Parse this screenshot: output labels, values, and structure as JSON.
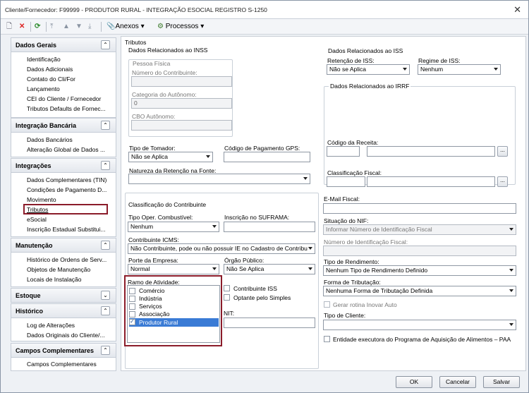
{
  "window": {
    "title": "Cliente/Fornecedor: F99999 - PRODUTOR RURAL - INTEGRAÇÃO ESOCIAL REGISTRO S-1250",
    "close": "✕"
  },
  "toolbar": {
    "anexos": "Anexos",
    "processos": "Processos"
  },
  "sidebar": {
    "dados_gerais": {
      "title": "Dados Gerais",
      "items": [
        "Identificação",
        "Dados Adicionais",
        "Contato do Cli/For",
        "Lançamento",
        "CEI do Cliente / Fornecedor",
        "Tributos Defaults de Fornec..."
      ]
    },
    "integracao_bancaria": {
      "title": "Integração Bancária",
      "items": [
        "Dados Bancários",
        "Alteração Global de Dados ..."
      ]
    },
    "integracoes": {
      "title": "Integrações",
      "items": [
        "Dados Complementares (TIN)",
        "Condições de Pagamento D...",
        "Movimento",
        "Tributos",
        "eSocial",
        "Inscrição Estadual Substitui..."
      ]
    },
    "manutencao": {
      "title": "Manutenção",
      "items": [
        "Histórico de Ordens de Serv...",
        "Objetos de Manutenção",
        "Locais de Instalação"
      ]
    },
    "estoque": {
      "title": "Estoque"
    },
    "historico": {
      "title": "Histórico",
      "items": [
        "Log de Alterações",
        "Dados Originais do Cliente/..."
      ]
    },
    "campos": {
      "title": "Campos Complementares",
      "items": [
        "Campos Complementares"
      ]
    }
  },
  "main": {
    "tab": "Tributos",
    "inss": {
      "title": "Dados Relacionados ao INSS",
      "pf": "Pessoa Física",
      "numero": "Número do Contribuinte:",
      "numero_val": "",
      "categoria": "Categoria do Autônomo:",
      "categoria_val": "0",
      "cbo": "CBO Autônomo:",
      "cbo_val": "",
      "tipo_tomador": "Tipo de Tomador:",
      "tipo_tomador_val": "Não se Aplica",
      "cod_gps": "Código de Pagamento GPS:",
      "natureza": "Natureza da Retenção na Fonte:",
      "natureza_val": ""
    },
    "iss": {
      "title": "Dados Relacionados ao ISS",
      "retencao": "Retenção de ISS:",
      "retencao_val": "Não se Aplica",
      "regime": "Regime de ISS:",
      "regime_val": "Nenhum"
    },
    "irrf": {
      "title": "Dados Relacionados ao IRRF",
      "cod_receita": "Código da Receita:",
      "classif": "Classificação Fiscal:",
      "dots": "..."
    },
    "contrib": {
      "title": "Classificação do Contribuinte",
      "tipo_oper": "Tipo Oper. Combustível:",
      "tipo_oper_val": "Nenhum",
      "suframa": "Inscrição no SUFRAMA:",
      "icms": "Contribuinte ICMS:",
      "icms_val": "Não Contribuinte, pode ou não possuir IE no Cadastro de Contribu",
      "porte": "Porte da Empresa:",
      "porte_val": "Normal",
      "orgao": "Órgão Público:",
      "orgao_val": "Não Se Aplica",
      "ramo": "Ramo de Atividade:",
      "ramo_items": [
        "Comércio",
        "Indústria",
        "Serviços",
        "Associação",
        "Produtor Rural"
      ],
      "contrib_iss": "Contribuinte ISS",
      "optante": "Optante pelo Simples",
      "nit": "NIT:"
    },
    "right": {
      "email": "E-Mail Fiscal:",
      "sit_nif": "Situação do NIF:",
      "sit_nif_val": "Informar Número de Identificação Fiscal",
      "num_nif": "Número de Identificação Fiscal:",
      "tipo_rend": "Tipo de Rendimento:",
      "tipo_rend_val": "Nenhum Tipo de Rendimento Definido",
      "forma_trib": "Forma de Tributação:",
      "forma_trib_val": "Nenhuma Forma de Tributação Definida",
      "gerar": "Gerar rotina Inovar Auto",
      "tipo_cliente": "Tipo de Cliente:",
      "entidade": "Entidade executora do Programa de Aquisição de Alimentos – PAA"
    }
  },
  "buttons": {
    "ok": "OK",
    "cancelar": "Cancelar",
    "salvar": "Salvar"
  }
}
